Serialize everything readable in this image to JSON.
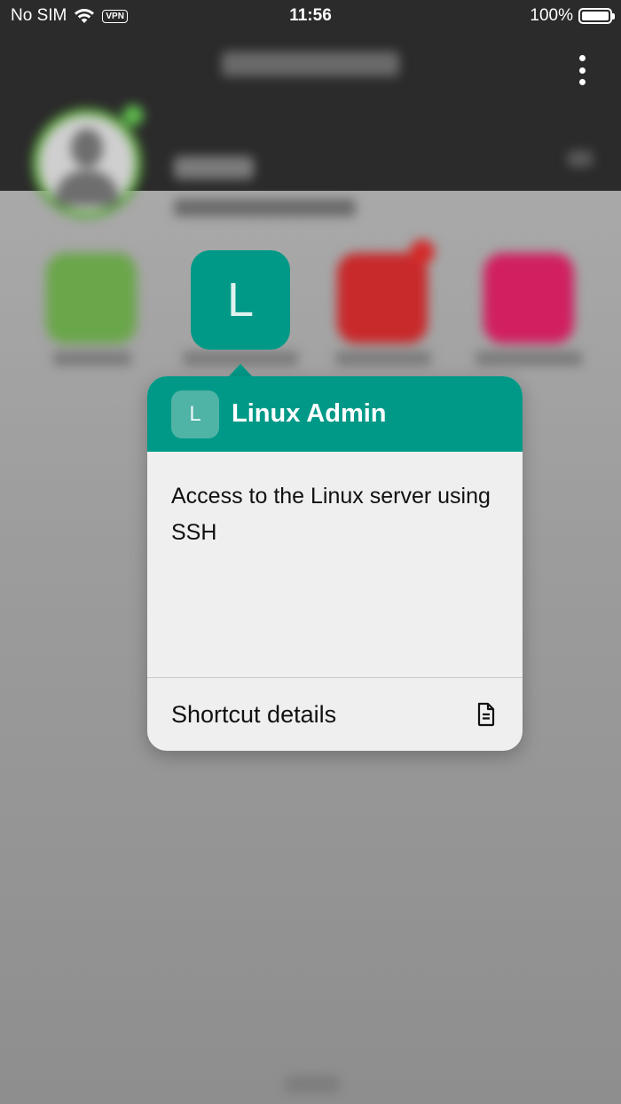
{
  "status_bar": {
    "carrier": "No SIM",
    "vpn": "VPN",
    "time": "11:56",
    "battery": "100%",
    "battery_level": 1.0
  },
  "tile": {
    "letter": "L",
    "color": "#009987"
  },
  "popover": {
    "badge_letter": "L",
    "title": "Linux Admin",
    "description": "Access to the Linux server using SSH",
    "footer_label": "Shortcut details",
    "footer_icon": "document-icon"
  },
  "colors": {
    "accent": "#009987",
    "popover_bg": "#efefef",
    "header_dark": "#2b2b2b"
  }
}
